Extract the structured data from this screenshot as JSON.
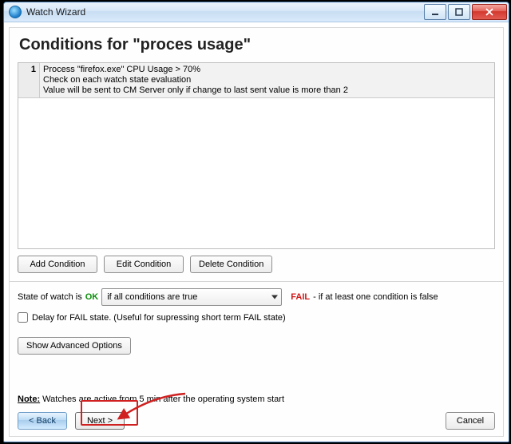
{
  "window": {
    "title": "Watch Wizard"
  },
  "heading": "Conditions for \"proces usage\"",
  "conditions": [
    {
      "num": "1",
      "line1": "Process \"firefox.exe\" CPU Usage > 70%",
      "line2": "Check on each watch state evaluation",
      "line3": "Value will be sent to CM Server only if change to last sent value is more than 2"
    }
  ],
  "buttons": {
    "add": "Add Condition",
    "edit": "Edit Condition",
    "delete": "Delete Condition",
    "advanced": "Show Advanced Options",
    "back": "< Back",
    "next": "Next >",
    "cancel": "Cancel"
  },
  "state": {
    "prefix": "State of watch is",
    "ok": "OK",
    "combo": "if all conditions are true",
    "fail": "FAIL",
    "suffix": "- if at least one condition is false"
  },
  "delay": {
    "label": "Delay for FAIL state. (Useful for supressing short term FAIL state)"
  },
  "note": {
    "label": "Note:",
    "text": "Watches are active from 5 min after the operating system start"
  }
}
